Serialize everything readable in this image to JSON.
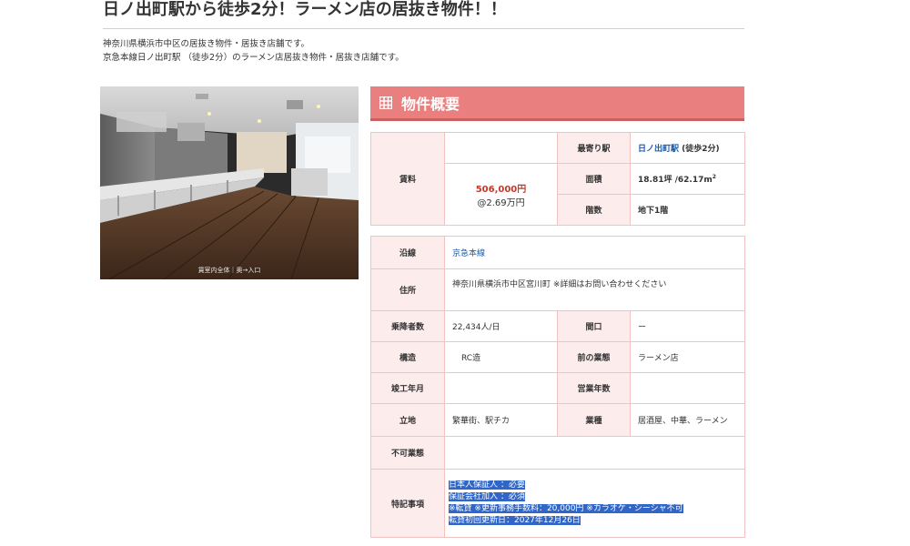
{
  "page": {
    "title": "日ノ出町駅から徒歩2分！ラーメン店の居抜き物件！！",
    "intro_lines": [
      "神奈川県横浜市中区の居抜き物件・居抜き店舗です。",
      "京急本線日ノ出町駅 （徒歩2分）のラーメン店居抜き物件・居抜き店舗です。"
    ]
  },
  "photo": {
    "caption": "賃室内全体｜奥→入口"
  },
  "summary": {
    "heading": "物件概要",
    "heading_icon": "table-grid-icon",
    "top": {
      "rent_label": "賃料",
      "rent_value": "506,000円",
      "rent_per_tsubo": "@2.69万円",
      "station_label": "最寄り駅",
      "station_name": "日ノ出町駅",
      "station_walk": " (徒歩2分)",
      "area_label": "面積",
      "area_value": "18.81坪 /62.17m",
      "area_sup": "2",
      "floor_label": "階数",
      "floor_value": "地下1階"
    },
    "details": {
      "line_label": "沿線",
      "line_value": "京急本線",
      "address_label": "住所",
      "address_value": "神奈川県横浜市中区宮川町 ※詳細はお問い合わせください",
      "passengers_label": "乗降者数",
      "passengers_value": "22,434人/日",
      "frontage_label": "間口",
      "frontage_value": "ー",
      "structure_label": "構造",
      "structure_value": "RC造",
      "previous_business_label": "前の業態",
      "previous_business_value": "ラーメン店",
      "completion_label": "竣工年月",
      "completion_value": "",
      "business_years_label": "営業年数",
      "business_years_value": "",
      "location_label": "立地",
      "location_value": "繁華街、駅チカ",
      "business_type_label": "業種",
      "business_type_value": "居酒屋、中華、ラーメン",
      "prohibited_label": "不可業態",
      "prohibited_value": "",
      "notes_label": "特記事項",
      "notes_lines": [
        "日本人保証人 ：必要",
        "保証会社加入 ：必須",
        "※転貸 ※更新事務手数料：20,000円 ※カラオケ・シーシャ不可",
        "転貸初回更新日：2027年12月26日"
      ]
    }
  },
  "colors": {
    "header_bg": "#ea7f7f",
    "label_bg": "#fcecec",
    "border": "#f0c2c2",
    "rent": "#c0392b",
    "link": "#1a5aa8",
    "selection": "#2f66c8"
  }
}
